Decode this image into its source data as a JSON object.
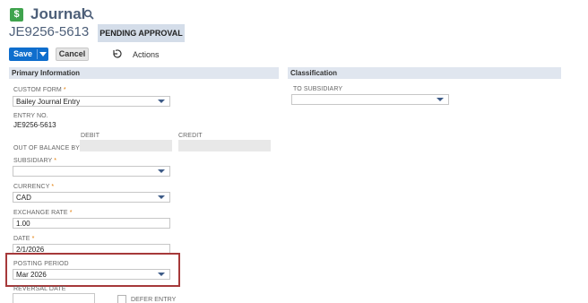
{
  "header": {
    "record_icon_glyph": "$",
    "record_type": "Journal",
    "record_id": "JE9256-5613",
    "status": "PENDING APPROVAL"
  },
  "toolbar": {
    "save_label": "Save",
    "cancel_label": "Cancel",
    "actions_label": "Actions"
  },
  "primary_section": {
    "title": "Primary Information",
    "custom_form": {
      "label": "CUSTOM FORM",
      "required_mark": "*",
      "value": "Bailey Journal Entry"
    },
    "entry_no": {
      "label": "ENTRY NO.",
      "value": "JE9256-5613"
    },
    "debit_label": "DEBIT",
    "credit_label": "CREDIT",
    "out_of_balance_label": "OUT OF BALANCE BY",
    "subsidiary": {
      "label": "SUBSIDIARY",
      "required_mark": "*",
      "value": ""
    },
    "currency": {
      "label": "CURRENCY",
      "required_mark": "*",
      "value": "CAD"
    },
    "exchange_rate": {
      "label": "EXCHANGE RATE",
      "required_mark": "*",
      "value": "1.00"
    },
    "date": {
      "label": "DATE",
      "required_mark": "*",
      "value": "2/1/2026"
    },
    "posting_period": {
      "label": "POSTING PERIOD",
      "value": "Mar 2026"
    },
    "reversal_date": {
      "label": "REVERSAL DATE",
      "value": ""
    },
    "defer_entry": {
      "label": "DEFER ENTRY",
      "checked": false
    }
  },
  "classification_section": {
    "title": "Classification",
    "to_subsidiary": {
      "label": "TO SUBSIDIARY",
      "value": ""
    }
  },
  "colors": {
    "primary_button": "#0f6ecd",
    "section_header_bg": "#e0e6ef",
    "status_badge_bg": "#d4dde9",
    "highlight_border": "#a6393a",
    "required_mark": "#e27a00",
    "record_icon": "#3fa34d"
  }
}
